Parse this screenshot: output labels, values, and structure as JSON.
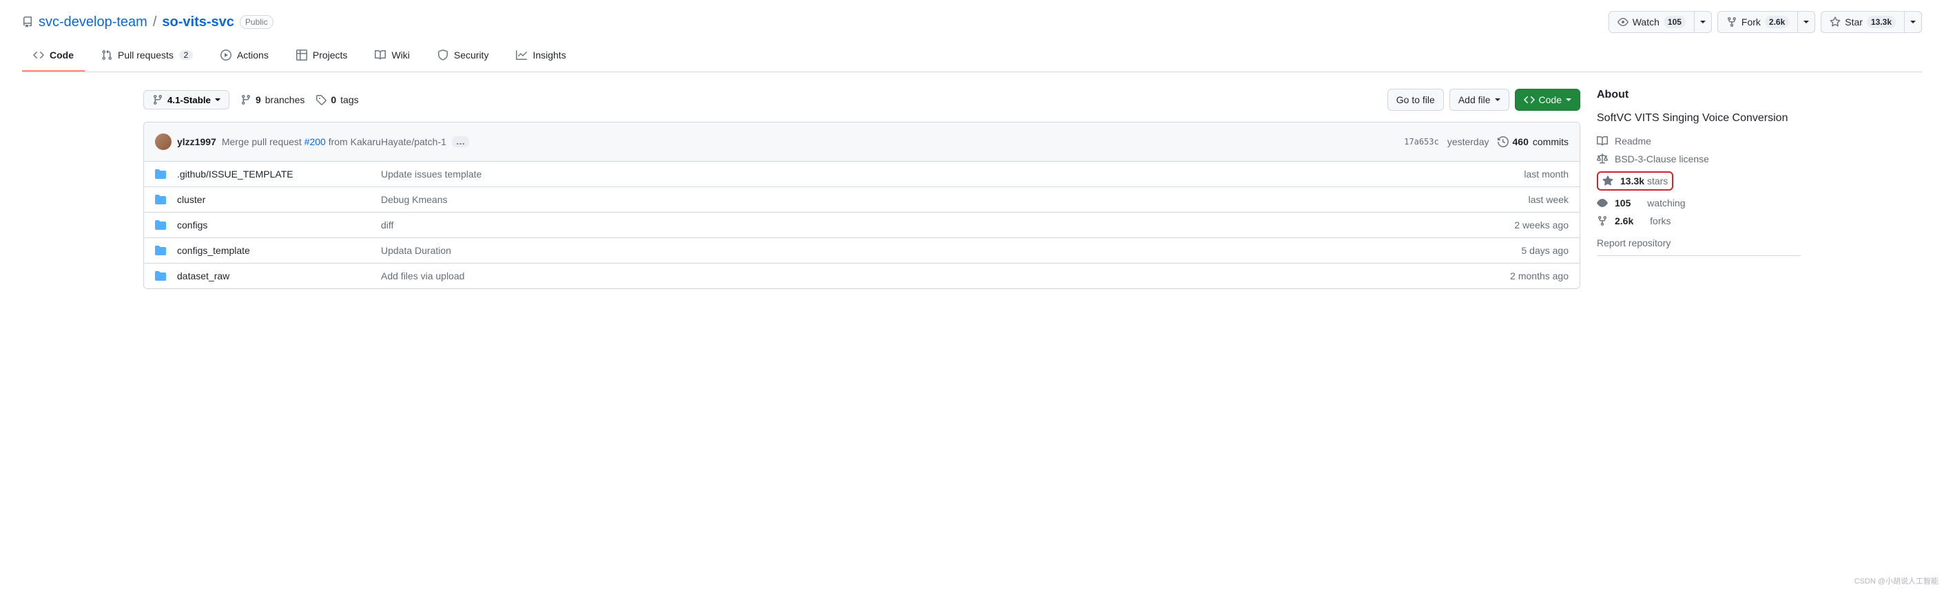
{
  "header": {
    "owner": "svc-develop-team",
    "repo": "so-vits-svc",
    "visibility": "Public"
  },
  "actions": {
    "watch": {
      "label": "Watch",
      "count": "105"
    },
    "fork": {
      "label": "Fork",
      "count": "2.6k"
    },
    "star": {
      "label": "Star",
      "count": "13.3k"
    }
  },
  "nav": {
    "code": "Code",
    "pulls": {
      "label": "Pull requests",
      "count": "2"
    },
    "actions": "Actions",
    "projects": "Projects",
    "wiki": "Wiki",
    "security": "Security",
    "insights": "Insights"
  },
  "branch": {
    "current": "4.1-Stable",
    "branches_count": "9",
    "branches_label": "branches",
    "tags_count": "0",
    "tags_label": "tags"
  },
  "file_buttons": {
    "goto": "Go to file",
    "add": "Add file",
    "code": "Code"
  },
  "latest_commit": {
    "author": "ylzz1997",
    "message_prefix": "Merge pull request ",
    "pr": "#200",
    "message_suffix": " from KakaruHayate/patch-1",
    "sha": "17a653c",
    "date": "yesterday",
    "commits_count": "460",
    "commits_label": "commits"
  },
  "files": [
    {
      "name": ".github/ISSUE_TEMPLATE",
      "msg": "Update issues template",
      "date": "last month"
    },
    {
      "name": "cluster",
      "msg": "Debug Kmeans",
      "date": "last week"
    },
    {
      "name": "configs",
      "msg": "diff",
      "date": "2 weeks ago"
    },
    {
      "name": "configs_template",
      "msg": "Updata Duration",
      "date": "5 days ago"
    },
    {
      "name": "dataset_raw",
      "msg": "Add files via upload",
      "date": "2 months ago"
    }
  ],
  "about": {
    "heading": "About",
    "description": "SoftVC VITS Singing Voice Conversion",
    "readme": "Readme",
    "license": "BSD-3-Clause license",
    "stars_count": "13.3k",
    "stars_label": "stars",
    "watching_count": "105",
    "watching_label": "watching",
    "forks_count": "2.6k",
    "forks_label": "forks",
    "report": "Report repository"
  },
  "watermark": "CSDN @小胡说人工智能"
}
